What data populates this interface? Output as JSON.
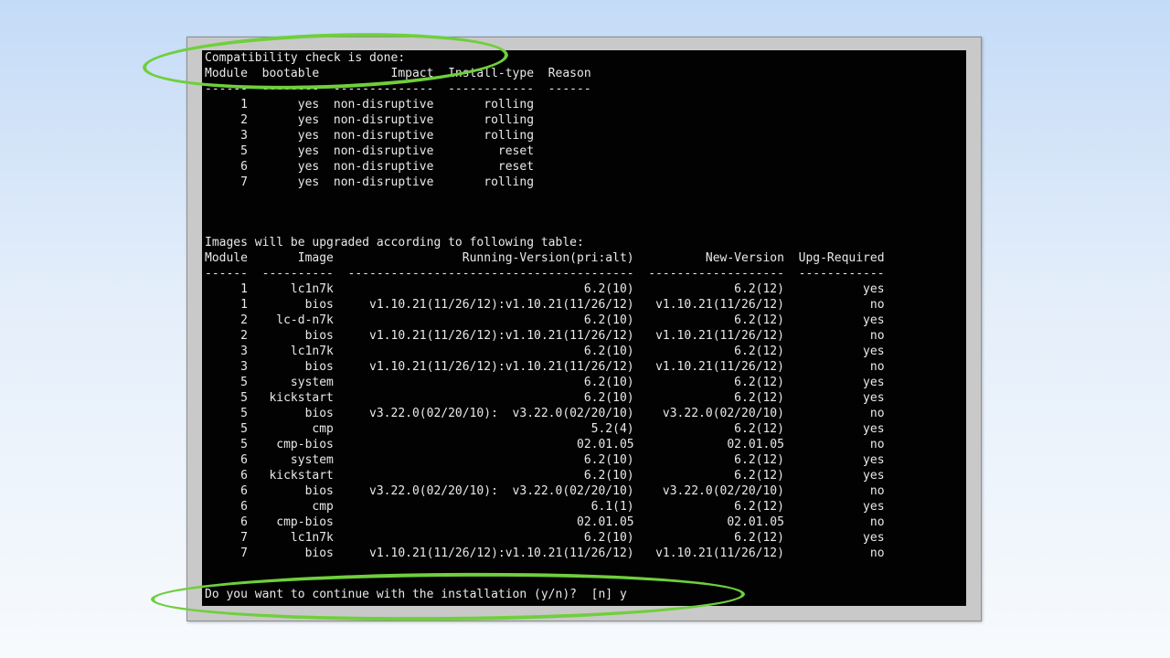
{
  "compat": {
    "title": "Compatibility check is done:",
    "headers": {
      "module": "Module",
      "bootable": "bootable",
      "impact": "Impact",
      "install_type": "Install-type",
      "reason": "Reason"
    },
    "rows": [
      {
        "module": "1",
        "bootable": "yes",
        "impact": "non-disruptive",
        "install_type": "rolling",
        "reason": ""
      },
      {
        "module": "2",
        "bootable": "yes",
        "impact": "non-disruptive",
        "install_type": "rolling",
        "reason": ""
      },
      {
        "module": "3",
        "bootable": "yes",
        "impact": "non-disruptive",
        "install_type": "rolling",
        "reason": ""
      },
      {
        "module": "5",
        "bootable": "yes",
        "impact": "non-disruptive",
        "install_type": "reset",
        "reason": ""
      },
      {
        "module": "6",
        "bootable": "yes",
        "impact": "non-disruptive",
        "install_type": "reset",
        "reason": ""
      },
      {
        "module": "7",
        "bootable": "yes",
        "impact": "non-disruptive",
        "install_type": "rolling",
        "reason": ""
      }
    ]
  },
  "images": {
    "title": "Images will be upgraded according to following table:",
    "headers": {
      "module": "Module",
      "image": "Image",
      "running": "Running-Version(pri:alt)",
      "new": "New-Version",
      "upg": "Upg-Required"
    },
    "rows": [
      {
        "module": "1",
        "image": "lc1n7k",
        "running": "6.2(10)",
        "new": "6.2(12)",
        "upg": "yes"
      },
      {
        "module": "1",
        "image": "bios",
        "running": "v1.10.21(11/26/12):v1.10.21(11/26/12)",
        "new": "v1.10.21(11/26/12)",
        "upg": "no"
      },
      {
        "module": "2",
        "image": "lc-d-n7k",
        "running": "6.2(10)",
        "new": "6.2(12)",
        "upg": "yes"
      },
      {
        "module": "2",
        "image": "bios",
        "running": "v1.10.21(11/26/12):v1.10.21(11/26/12)",
        "new": "v1.10.21(11/26/12)",
        "upg": "no"
      },
      {
        "module": "3",
        "image": "lc1n7k",
        "running": "6.2(10)",
        "new": "6.2(12)",
        "upg": "yes"
      },
      {
        "module": "3",
        "image": "bios",
        "running": "v1.10.21(11/26/12):v1.10.21(11/26/12)",
        "new": "v1.10.21(11/26/12)",
        "upg": "no"
      },
      {
        "module": "5",
        "image": "system",
        "running": "6.2(10)",
        "new": "6.2(12)",
        "upg": "yes"
      },
      {
        "module": "5",
        "image": "kickstart",
        "running": "6.2(10)",
        "new": "6.2(12)",
        "upg": "yes"
      },
      {
        "module": "5",
        "image": "bios",
        "running": "v3.22.0(02/20/10):  v3.22.0(02/20/10)",
        "new": "v3.22.0(02/20/10)",
        "upg": "no"
      },
      {
        "module": "5",
        "image": "cmp",
        "running": "5.2(4)",
        "new": "6.2(12)",
        "upg": "yes"
      },
      {
        "module": "5",
        "image": "cmp-bios",
        "running": "02.01.05",
        "new": "02.01.05",
        "upg": "no"
      },
      {
        "module": "6",
        "image": "system",
        "running": "6.2(10)",
        "new": "6.2(12)",
        "upg": "yes"
      },
      {
        "module": "6",
        "image": "kickstart",
        "running": "6.2(10)",
        "new": "6.2(12)",
        "upg": "yes"
      },
      {
        "module": "6",
        "image": "bios",
        "running": "v3.22.0(02/20/10):  v3.22.0(02/20/10)",
        "new": "v3.22.0(02/20/10)",
        "upg": "no"
      },
      {
        "module": "6",
        "image": "cmp",
        "running": "6.1(1)",
        "new": "6.2(12)",
        "upg": "yes"
      },
      {
        "module": "6",
        "image": "cmp-bios",
        "running": "02.01.05",
        "new": "02.01.05",
        "upg": "no"
      },
      {
        "module": "7",
        "image": "lc1n7k",
        "running": "6.2(10)",
        "new": "6.2(12)",
        "upg": "yes"
      },
      {
        "module": "7",
        "image": "bios",
        "running": "v1.10.21(11/26/12):v1.10.21(11/26/12)",
        "new": "v1.10.21(11/26/12)",
        "upg": "no"
      }
    ]
  },
  "prompt": {
    "text": "Do you want to continue with the installation (y/n)?",
    "default": "[n]",
    "answer": "y"
  },
  "colors": {
    "terminal_bg": "#020202",
    "terminal_text": "#e9e9e9",
    "highlight": "#6fcf3c"
  }
}
